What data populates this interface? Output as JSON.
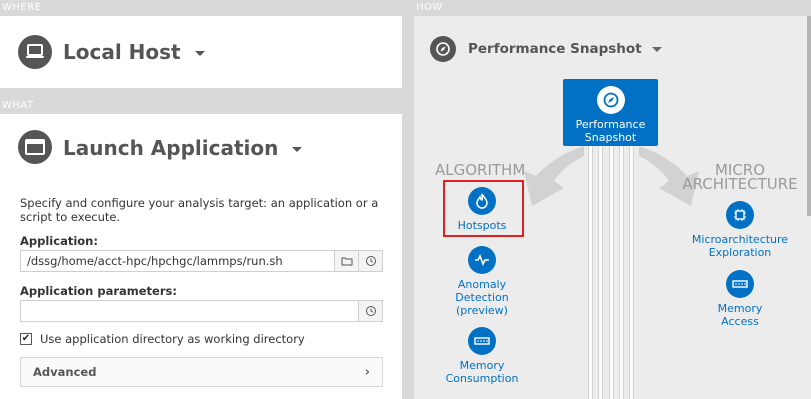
{
  "where": {
    "section_label": "WHERE",
    "title": "Local Host",
    "icon": "laptop-icon"
  },
  "what": {
    "section_label": "WHAT",
    "title": "Launch Application",
    "icon": "application-window-icon",
    "description": "Specify and configure your analysis target: an application or a script to execute.",
    "application_label": "Application:",
    "application_value": "/dssg/home/acct-hpc/hpchgc/lammps/run.sh",
    "params_label": "Application parameters:",
    "params_value": "",
    "use_app_dir_label": "Use application directory as working directory",
    "use_app_dir_checked": true,
    "advanced_label": "Advanced"
  },
  "how": {
    "section_label": "HOW",
    "title": "Performance Snapshot",
    "snapshot_box_label_1": "Performance",
    "snapshot_box_label_2": "Snapshot",
    "algorithm_label": "ALGORITHM",
    "micro_label_1": "MICRO",
    "micro_label_2": "ARCHITECTURE",
    "algorithm_items": [
      {
        "line1": "Hotspots",
        "line2": "",
        "line3": "",
        "icon": "flame-icon",
        "highlighted": true
      },
      {
        "line1": "Anomaly",
        "line2": "Detection",
        "line3": "(preview)",
        "icon": "pulse-icon"
      },
      {
        "line1": "Memory",
        "line2": "Consumption",
        "line3": "",
        "icon": "memory-chip-icon"
      }
    ],
    "micro_items": [
      {
        "line1": "Microarchitecture",
        "line2": "Exploration",
        "icon": "cpu-chip-icon"
      },
      {
        "line1": "Memory",
        "line2": "Access",
        "icon": "memory-chip-icon"
      }
    ],
    "colors": {
      "accent": "#0071c5",
      "highlight": "#e02020"
    }
  }
}
